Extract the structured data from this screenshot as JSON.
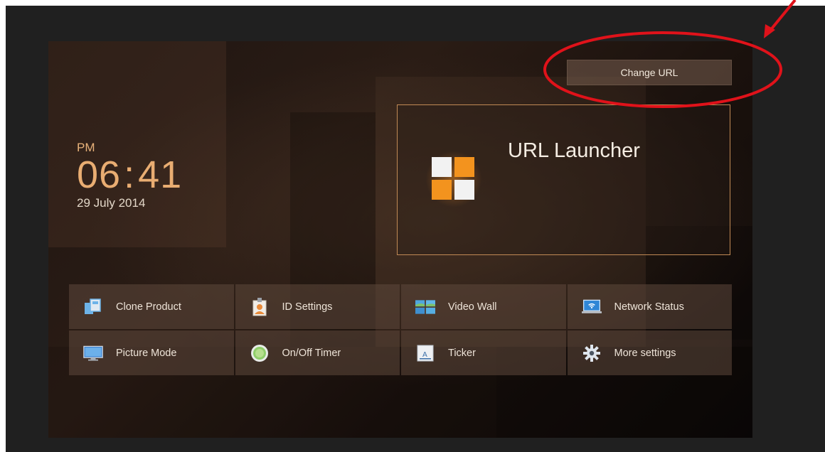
{
  "clock": {
    "ampm": "PM",
    "hours": "06",
    "minutes": "41",
    "date": "29 July 2014"
  },
  "header": {
    "change_url_label": "Change URL"
  },
  "launcher": {
    "title": "URL Launcher",
    "icon_colors": {
      "orange": "#f3931e",
      "white": "#f2f2f2"
    }
  },
  "menu": {
    "items": [
      {
        "label": "Clone Product",
        "icon": "clone-product-icon"
      },
      {
        "label": "ID Settings",
        "icon": "id-settings-icon"
      },
      {
        "label": "Video Wall",
        "icon": "video-wall-icon"
      },
      {
        "label": "Network Status",
        "icon": "network-status-icon"
      },
      {
        "label": "Picture Mode",
        "icon": "picture-mode-icon"
      },
      {
        "label": "On/Off Timer",
        "icon": "on-off-timer-icon"
      },
      {
        "label": "Ticker",
        "icon": "ticker-icon"
      },
      {
        "label": "More settings",
        "icon": "gear-icon"
      }
    ]
  },
  "annotation": {
    "color": "#e0121a"
  }
}
